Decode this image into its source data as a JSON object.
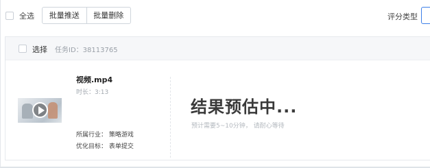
{
  "toolbar": {
    "select_all_label": "全选",
    "batch_push_label": "批量推送",
    "batch_delete_label": "批量删除",
    "rating_type_label": "评分类型"
  },
  "task": {
    "select_label": "选择",
    "task_id_label": "任务ID：",
    "task_id_value": "38113765",
    "video": {
      "name": "视频.mp4",
      "duration": "时长：3:13",
      "thumbnail_icon": "play-icon"
    },
    "industry": "所属行业：  策略游戏",
    "goal": "优化目标：  表单提交",
    "result": {
      "title": "结果预估中...",
      "subtitle": "预计需要5~10分钟， 请耐心等待"
    }
  },
  "colors": {
    "accent": "#3b7ee8",
    "header_bg": "#f6f7f9",
    "border": "#e6e9ed"
  }
}
